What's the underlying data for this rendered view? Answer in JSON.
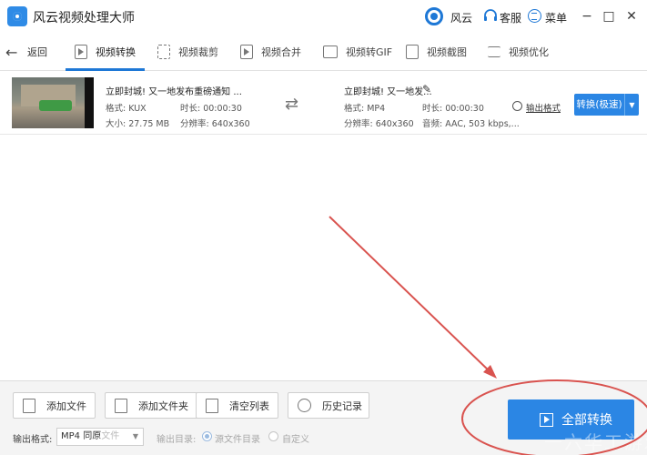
{
  "app": {
    "title": "风云视频处理大师"
  },
  "header": {
    "user_name": "风云",
    "service_label": "客服",
    "menu_label": "菜单",
    "min_symbol": "−",
    "restore_symbol": "□",
    "close_symbol": "✕"
  },
  "nav": {
    "back_label": "返回",
    "items": [
      {
        "label": "视频转换",
        "icon": "play-doc-icon",
        "active": true
      },
      {
        "label": "视频裁剪",
        "icon": "crop-icon"
      },
      {
        "label": "视频合并",
        "icon": "merge-icon"
      },
      {
        "label": "视频转GIF",
        "icon": "gif-icon"
      },
      {
        "label": "视频截图",
        "icon": "screenshot-icon"
      },
      {
        "label": "视频优化",
        "icon": "sliders-icon"
      }
    ]
  },
  "file": {
    "source": {
      "title": "立即封城! 又一地发布重磅通知 ...",
      "format": "格式: KUX",
      "duration": "时长: 00:00:30",
      "size": "大小: 27.75 MB",
      "resolution": "分辨率: 640x360"
    },
    "output": {
      "title": "立即封城! 又一地发...",
      "format": "格式: MP4",
      "duration": "时长: 00:00:30",
      "resolution": "分辨率: 640x360",
      "audio": "音频: AAC, 503 kbps,..."
    },
    "output_format_label": "输出格式",
    "convert_label": "转换(极速)"
  },
  "actions": [
    {
      "label": "添加文件",
      "icon": "add-file-icon"
    },
    {
      "label": "添加文件夹",
      "icon": "add-folder-icon"
    },
    {
      "label": "清空列表",
      "icon": "trash-icon"
    },
    {
      "label": "历史记录",
      "icon": "clock-icon"
    }
  ],
  "options": {
    "format_label": "输出格式:",
    "format_value": "MP4 同原",
    "format_ghost": "文件",
    "dir_label": "输出目录:",
    "dir_source": "源文件目录",
    "dir_custom": "自定义"
  },
  "convert_all_label": "全部转换",
  "watermark": "一六华工游戏",
  "colors": {
    "accent": "#2b86e4",
    "annotation": "#d9534f"
  }
}
